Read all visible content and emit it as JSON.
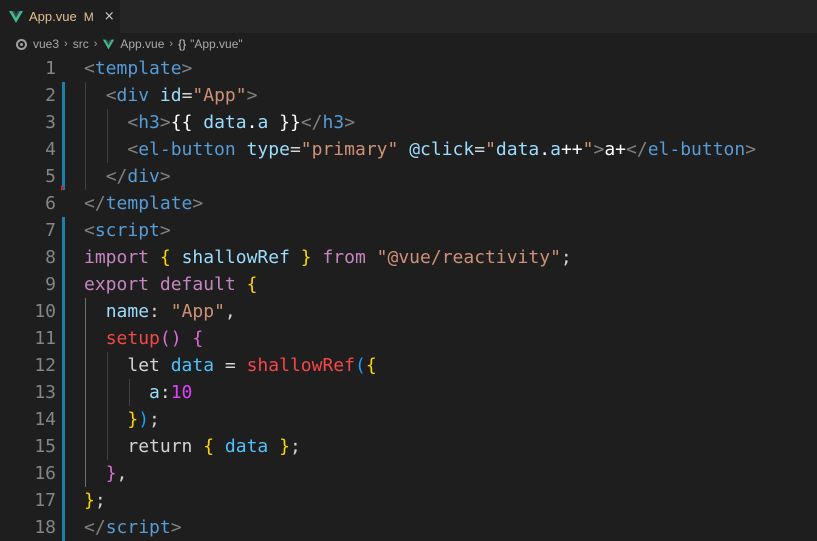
{
  "tab": {
    "label": "App.vue",
    "modified": "M",
    "close": "×",
    "icon": "vue-logo-icon"
  },
  "breadcrumb": {
    "items": [
      "vue3",
      "src",
      "App.vue",
      "\"App.vue\""
    ],
    "separator": "›",
    "symbol_icon": "{}"
  },
  "colors": {
    "vue_green": "#41b883",
    "vue_dark": "#34495e",
    "modified": "#e2c08d",
    "gutter_change": "#1b81a8"
  },
  "editor": {
    "line_numbers": [
      "1",
      "2",
      "3",
      "4",
      "5",
      "6",
      "7",
      "8",
      "9",
      "10",
      "11",
      "12",
      "13",
      "14",
      "15",
      "16",
      "17",
      "18"
    ],
    "lines": [
      [
        [
          "t-punc",
          "<"
        ],
        [
          "t-tag",
          "template"
        ],
        [
          "t-punc",
          ">"
        ]
      ],
      [
        [
          "t-text",
          "  "
        ],
        [
          "t-punc",
          "<"
        ],
        [
          "t-tag",
          "div"
        ],
        [
          "t-text",
          " "
        ],
        [
          "t-attr",
          "id"
        ],
        [
          "t-text",
          "="
        ],
        [
          "t-str",
          "\"App\""
        ],
        [
          "t-punc",
          ">"
        ]
      ],
      [
        [
          "t-text",
          "    "
        ],
        [
          "t-punc",
          "<"
        ],
        [
          "t-tag",
          "h3"
        ],
        [
          "t-punc",
          ">"
        ],
        [
          "t-white",
          "{{ "
        ],
        [
          "t-prop",
          "data"
        ],
        [
          "t-white",
          "."
        ],
        [
          "t-prop",
          "a"
        ],
        [
          "t-white",
          " }}"
        ],
        [
          "t-punc",
          "</"
        ],
        [
          "t-tag",
          "h3"
        ],
        [
          "t-punc",
          ">"
        ]
      ],
      [
        [
          "t-text",
          "    "
        ],
        [
          "t-punc",
          "<"
        ],
        [
          "t-tag",
          "el-button"
        ],
        [
          "t-text",
          " "
        ],
        [
          "t-attr",
          "type"
        ],
        [
          "t-text",
          "="
        ],
        [
          "t-str",
          "\"primary\""
        ],
        [
          "t-text",
          " "
        ],
        [
          "t-attr",
          "@click"
        ],
        [
          "t-text",
          "="
        ],
        [
          "t-str",
          "\""
        ],
        [
          "t-prop",
          "data"
        ],
        [
          "t-white",
          "."
        ],
        [
          "t-prop",
          "a"
        ],
        [
          "t-white",
          "++"
        ],
        [
          "t-str",
          "\""
        ],
        [
          "t-punc",
          ">"
        ],
        [
          "t-white",
          "a+"
        ],
        [
          "t-punc",
          "</"
        ],
        [
          "t-tag",
          "el-button"
        ],
        [
          "t-punc",
          ">"
        ]
      ],
      [
        [
          "t-text",
          "  "
        ],
        [
          "t-punc",
          "</"
        ],
        [
          "t-tag",
          "div"
        ],
        [
          "t-punc",
          ">"
        ]
      ],
      [
        [
          "t-punc",
          "</"
        ],
        [
          "t-tag",
          "template"
        ],
        [
          "t-punc",
          ">"
        ]
      ],
      [
        [
          "t-punc",
          "<"
        ],
        [
          "t-tag",
          "script"
        ],
        [
          "t-punc",
          ">"
        ]
      ],
      [
        [
          "t-kw",
          "import"
        ],
        [
          "t-text",
          " "
        ],
        [
          "b1",
          "{"
        ],
        [
          "t-text",
          " "
        ],
        [
          "t-prop",
          "shallowRef"
        ],
        [
          "t-text",
          " "
        ],
        [
          "b1",
          "}"
        ],
        [
          "t-text",
          " "
        ],
        [
          "t-kw",
          "from"
        ],
        [
          "t-text",
          " "
        ],
        [
          "t-str",
          "\"@vue/reactivity\""
        ],
        [
          "t-text",
          ";"
        ]
      ],
      [
        [
          "t-kw",
          "export"
        ],
        [
          "t-text",
          " "
        ],
        [
          "t-kw",
          "default"
        ],
        [
          "t-text",
          " "
        ],
        [
          "b1",
          "{"
        ]
      ],
      [
        [
          "t-text",
          "  "
        ],
        [
          "t-prop",
          "name"
        ],
        [
          "t-text",
          ": "
        ],
        [
          "t-str",
          "\"App\""
        ],
        [
          "t-text",
          ","
        ]
      ],
      [
        [
          "t-text",
          "  "
        ],
        [
          "t-fn",
          "setup"
        ],
        [
          "b2",
          "()"
        ],
        [
          "t-text",
          " "
        ],
        [
          "b2",
          "{"
        ]
      ],
      [
        [
          "t-text",
          "    "
        ],
        [
          "t-kw2",
          "let"
        ],
        [
          "t-text",
          " "
        ],
        [
          "t-var",
          "data"
        ],
        [
          "t-text",
          " = "
        ],
        [
          "t-fn",
          "shallowRef"
        ],
        [
          "b3",
          "("
        ],
        [
          "b1",
          "{"
        ]
      ],
      [
        [
          "t-text",
          "      "
        ],
        [
          "t-prop",
          "a"
        ],
        [
          "t-text",
          ":"
        ],
        [
          "t-num2",
          "10"
        ]
      ],
      [
        [
          "t-text",
          "    "
        ],
        [
          "b1",
          "}"
        ],
        [
          "b3",
          ")"
        ],
        [
          "t-text",
          ";"
        ]
      ],
      [
        [
          "t-text",
          "    "
        ],
        [
          "t-kw2",
          "return"
        ],
        [
          "t-text",
          " "
        ],
        [
          "b1",
          "{"
        ],
        [
          "t-text",
          " "
        ],
        [
          "t-var",
          "data"
        ],
        [
          "t-text",
          " "
        ],
        [
          "b1",
          "}"
        ],
        [
          "t-text",
          ";"
        ]
      ],
      [
        [
          "t-text",
          "  "
        ],
        [
          "b2",
          "}"
        ],
        [
          "t-text",
          ","
        ]
      ],
      [
        [
          "b1",
          "}"
        ],
        [
          "t-text",
          ";"
        ]
      ],
      [
        [
          "t-punc",
          "</"
        ],
        [
          "t-tag",
          "script"
        ],
        [
          "t-punc",
          ">"
        ]
      ]
    ]
  }
}
